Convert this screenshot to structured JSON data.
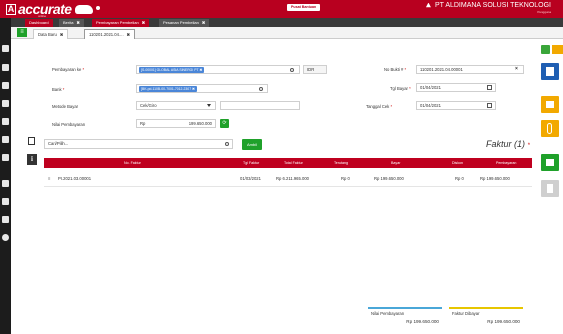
{
  "app": {
    "logo_text": "accurate",
    "logo_sub": "online",
    "pusat_badge": "Pusat Bantuan",
    "company_name": "PT ALDIMANA SOLUSI TEKNOLOGI",
    "company_sub": "Pengguna"
  },
  "menu_tabs": [
    {
      "label": "Dashboard",
      "close": ""
    },
    {
      "label": "Berita",
      "close": "✖"
    },
    {
      "label": "Pembayaran Pembelian",
      "close": "✖"
    },
    {
      "label": "Pesanan Pembelian",
      "close": "✖"
    }
  ],
  "sub_tabs": [
    {
      "label": "Data Baru",
      "close": "✖"
    },
    {
      "label": "110201.2021.04....",
      "close": "✖"
    }
  ],
  "form": {
    "pembayaran_ke_label": "Pembayaran ke",
    "pembayaran_ke_chip": "[S-00001] GLOBAL ASIA SINERGI PT ✖",
    "pembayaran_ke_currency": "IDR",
    "bank_label": "Bank",
    "bank_chip": "[BK-pd-110B-00-7001-7012-2307 ✖",
    "metode_label": "Metode Bayar",
    "metode_value": "Cek/Giro",
    "nilai_label": "Nilai Pembayaran",
    "nilai_prefix": "Rp",
    "nilai_value": "199.650.000",
    "no_bukti_label": "No Bukti #",
    "no_bukti_value": "110201.2021.04.00001",
    "tgl_bayar_label": "Tgl Bayar",
    "tgl_bayar_value": "01/04/2021",
    "tanggal_cek_label": "Tanggal Cek",
    "tanggal_cek_value": "01/04/2021",
    "required_mark": "*"
  },
  "invoices": {
    "search_placeholder": "Cari/Pilih...",
    "add_label": "Ambil",
    "faktur_title": "Faktur (1)",
    "columns": [
      "No. Faktur",
      "Tgl Faktur",
      "Total Faktur",
      "Terutang",
      "Bayar",
      "Diskon",
      "Pembayaran"
    ],
    "rows": [
      {
        "handle": "≡",
        "no": "PI.2021.03.00001",
        "tgl": "01/03/2021",
        "total": "Rp 6.211.965.000",
        "terutang": "Rp 0",
        "bayar": "Rp 199.650.000",
        "diskon": "Rp 0",
        "pembayaran": "Rp 199.650.000"
      }
    ]
  },
  "summary": {
    "nilai_label": "Nilai Pembayaran",
    "nilai_value": "Rp 199.650.000",
    "faktur_label": "Faktur Dibayar",
    "faktur_value": "Rp 199.650.000"
  },
  "colors": {
    "brand_red": "#b8001f",
    "green": "#1fa12a",
    "save_blue": "#1f5fb3",
    "print_orange": "#f2a900"
  },
  "icons": [
    "menu-icon",
    "save-icon",
    "print-icon",
    "attach-icon",
    "distribute-icon",
    "delete-icon",
    "info-icon",
    "search-icon",
    "calendar-icon"
  ]
}
